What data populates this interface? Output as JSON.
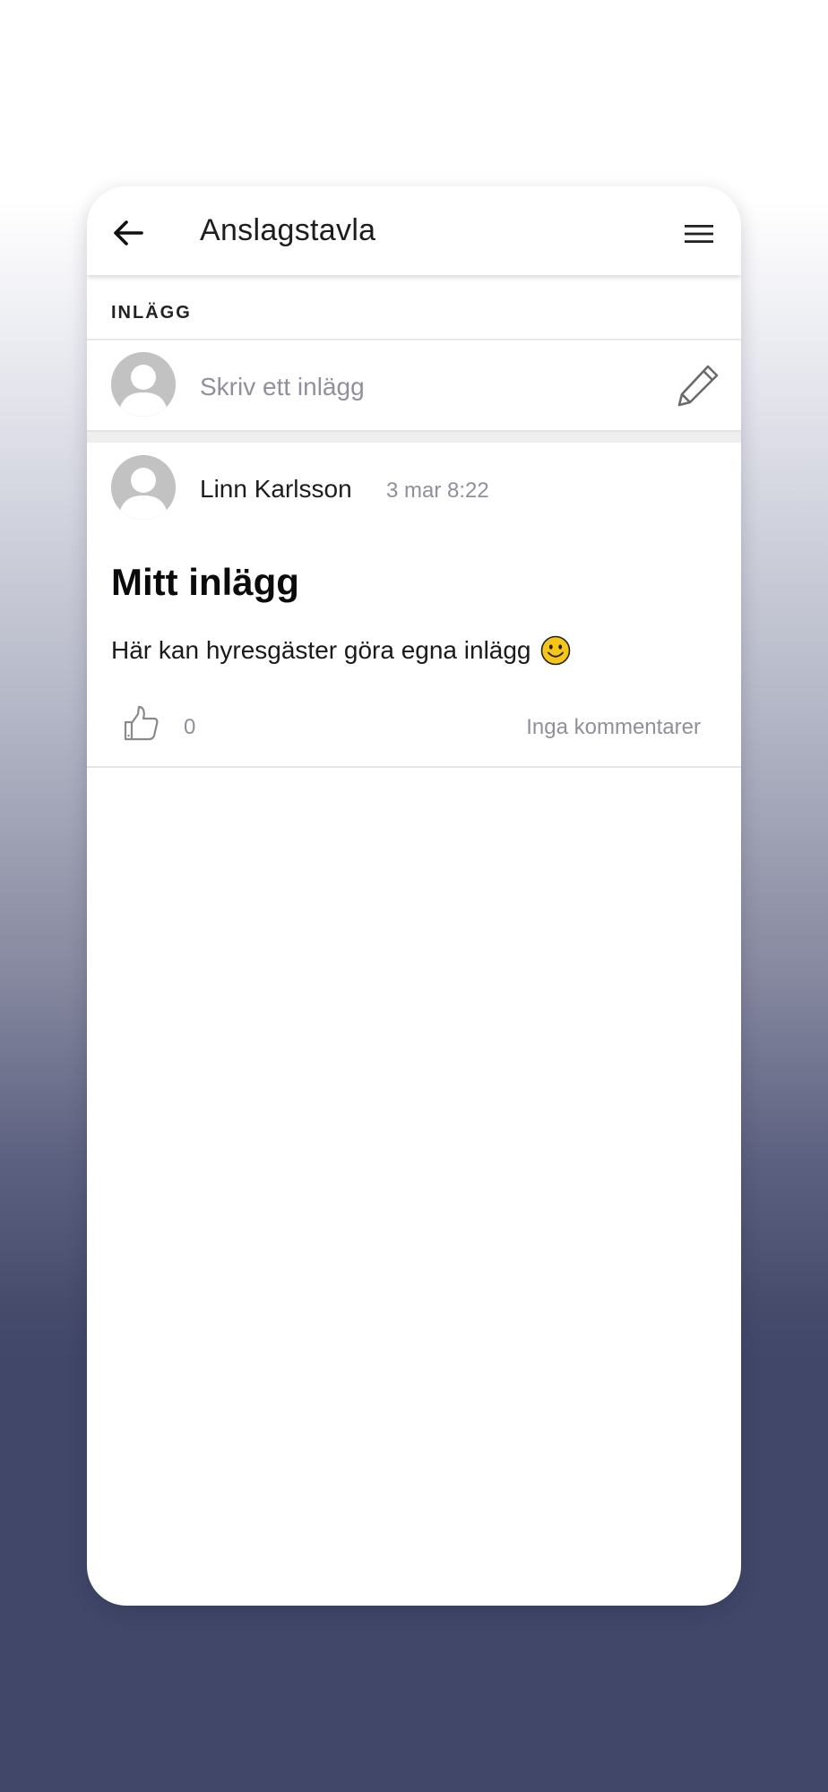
{
  "header": {
    "title": "Anslagstavla",
    "back_icon": "arrow-left-icon",
    "menu_icon": "hamburger-menu-icon"
  },
  "section": {
    "label": "INLÄGG"
  },
  "composer": {
    "placeholder": "Skriv ett inlägg",
    "edit_icon": "pencil-icon"
  },
  "post": {
    "author": "Linn Karlsson",
    "timestamp": "3 mar 8:22",
    "title": "Mitt inlägg",
    "body": "Här kan hyresgäster göra egna inlägg",
    "emoji_icon": "smiley-emoji-icon",
    "likes": "0",
    "comments_label": "Inga kommentarer"
  },
  "colors": {
    "background_top": "#ffffff",
    "background_bottom": "#404769",
    "muted_text": "#8f9099",
    "avatar_gray": "#c2c2c2",
    "emoji_yellow": "#f5c518"
  }
}
